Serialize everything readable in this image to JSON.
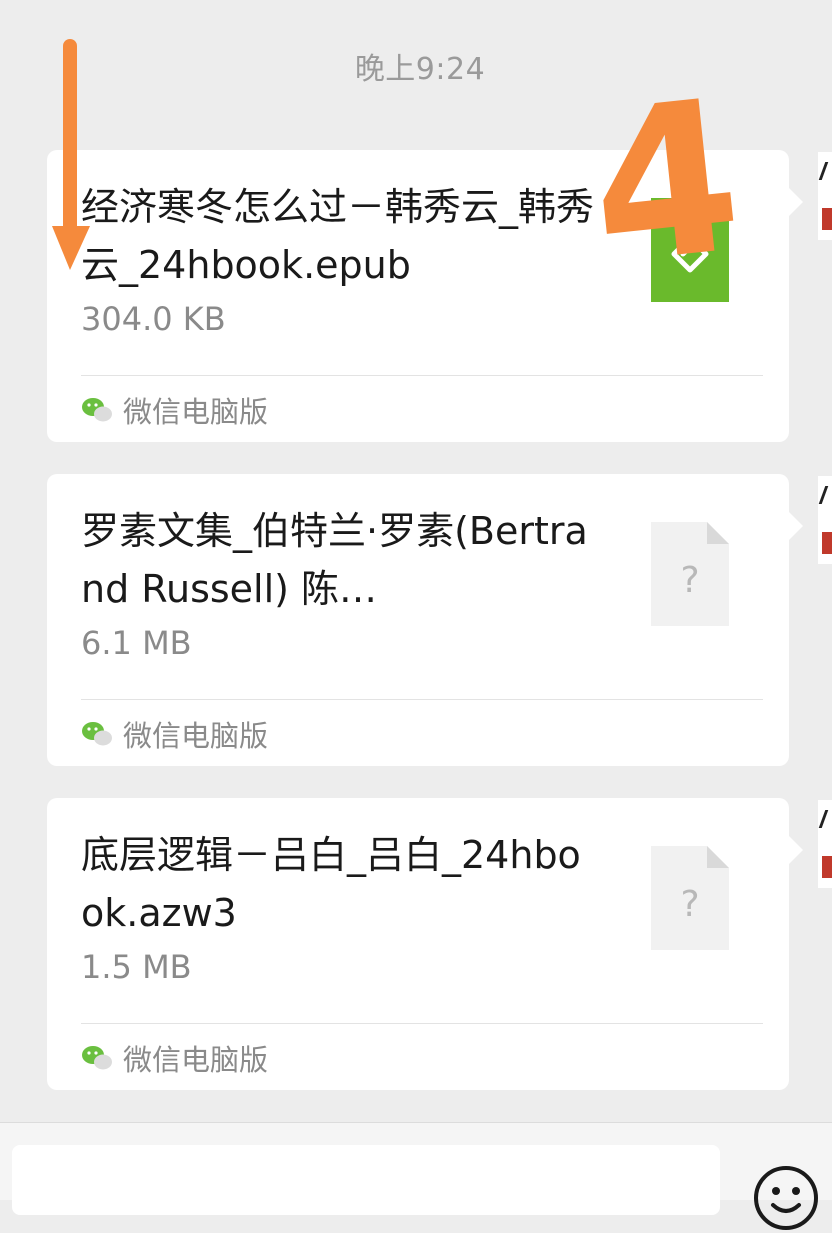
{
  "chat": {
    "timestamp": "晚上9:24",
    "messages": [
      {
        "file_name": "经济寒冬怎么过－韩秀云_韩秀云_24hbook.epub",
        "file_size": "304.0 KB",
        "source": "微信电脑版",
        "icon": "epub-file-icon"
      },
      {
        "file_name": "罗素文集_伯特兰·罗素(Bertrand Russell) 陈…",
        "file_size": "6.1 MB",
        "source": "微信电脑版",
        "icon": "unknown-file-icon"
      },
      {
        "file_name": "底层逻辑－吕白_吕白_24hbook.azw3",
        "file_size": "1.5 MB",
        "source": "微信电脑版",
        "icon": "unknown-file-icon"
      }
    ]
  },
  "annotation": {
    "number": "4",
    "color": "#f58a3c"
  },
  "colors": {
    "epub_green": "#6aba2c",
    "unknown_gray": "#f1f1f1",
    "wechat_green": "#6abf3f"
  },
  "input_bar": {
    "emoji_icon": "emoji-icon"
  }
}
